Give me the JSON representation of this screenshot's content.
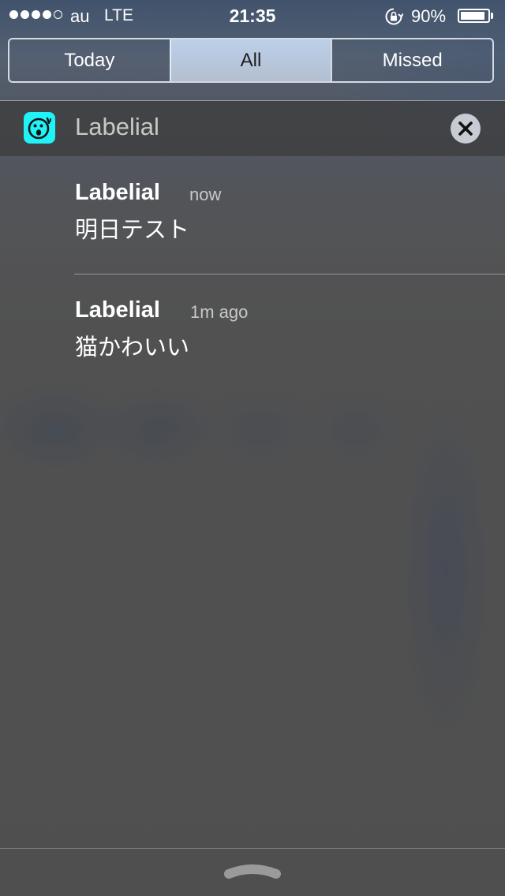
{
  "status_bar": {
    "signal_dots_filled": 4,
    "signal_dots_total": 5,
    "carrier": "au",
    "network": "LTE",
    "time": "21:35",
    "rotation_lock_icon": "rotation-lock-icon",
    "battery_percent_text": "90%",
    "battery_level": 0.9
  },
  "tabs": [
    {
      "label": "Today",
      "selected": false
    },
    {
      "label": "All",
      "selected": true
    },
    {
      "label": "Missed",
      "selected": false
    }
  ],
  "app_section": {
    "name": "Labelial",
    "icon": "labelial-app-icon",
    "icon_color": "#1ff3f7",
    "clear_icon": "close-icon"
  },
  "notifications": [
    {
      "title": "Labelial",
      "time": "now",
      "body": "明日テスト"
    },
    {
      "title": "Labelial",
      "time": "1m ago",
      "body": "猫かわいい"
    }
  ],
  "grabber_icon": "chevron-up-icon"
}
